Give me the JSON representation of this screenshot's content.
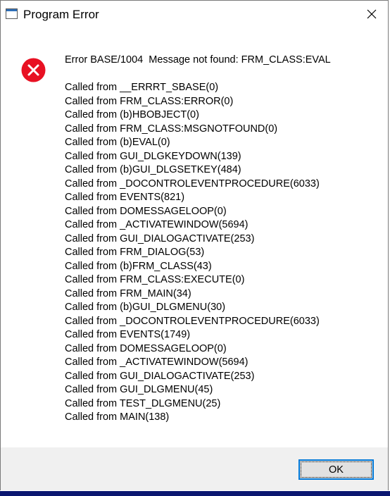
{
  "window": {
    "title": "Program Error",
    "close_icon": "close-icon",
    "app_icon": "window-app-icon"
  },
  "message": {
    "icon": "error-icon",
    "icon_color": "#e81123",
    "headline": "Error BASE/1004  Message not found: FRM_CLASS:EVAL",
    "call_stack": [
      "Called from __ERRRT_SBASE(0)",
      "Called from FRM_CLASS:ERROR(0)",
      "Called from (b)HBOBJECT(0)",
      "Called from FRM_CLASS:MSGNOTFOUND(0)",
      "Called from (b)EVAL(0)",
      "Called from GUI_DLGKEYDOWN(139)",
      "Called from (b)GUI_DLGSETKEY(484)",
      "Called from _DOCONTROLEVENTPROCEDURE(6033)",
      "Called from EVENTS(821)",
      "Called from DOMESSAGELOOP(0)",
      "Called from _ACTIVATEWINDOW(5694)",
      "Called from GUI_DIALOGACTIVATE(253)",
      "Called from FRM_DIALOG(53)",
      "Called from (b)FRM_CLASS(43)",
      "Called from FRM_CLASS:EXECUTE(0)",
      "Called from FRM_MAIN(34)",
      "Called from (b)GUI_DLGMENU(30)",
      "Called from _DOCONTROLEVENTPROCEDURE(6033)",
      "Called from EVENTS(1749)",
      "Called from DOMESSAGELOOP(0)",
      "Called from _ACTIVATEWINDOW(5694)",
      "Called from GUI_DIALOGACTIVATE(253)",
      "Called from GUI_DLGMENU(45)",
      "Called from TEST_DLGMENU(25)",
      "Called from MAIN(138)"
    ]
  },
  "footer": {
    "ok_label": "OK",
    "accent_color": "#0078d7"
  }
}
